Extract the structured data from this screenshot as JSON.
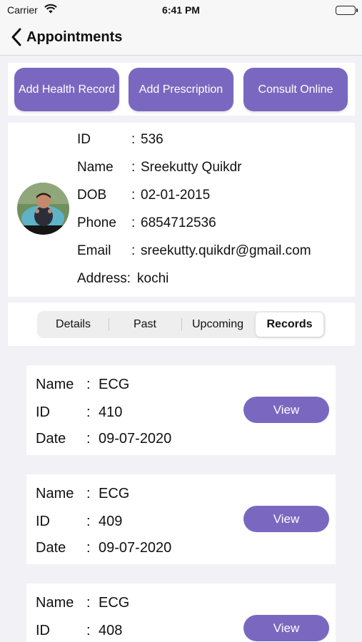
{
  "status_bar": {
    "carrier": "Carrier",
    "time": "6:41 PM"
  },
  "nav": {
    "back_label": "Appointments"
  },
  "actions": [
    {
      "label": "Add Health Record"
    },
    {
      "label": "Add Prescription"
    },
    {
      "label": "Consult Online"
    }
  ],
  "patient": {
    "fields": [
      {
        "label": "ID",
        "sep": ":",
        "value": "536"
      },
      {
        "label": "Name",
        "sep": ":",
        "value": "Sreekutty Quikdr"
      },
      {
        "label": "DOB",
        "sep": ":",
        "value": "02-01-2015"
      },
      {
        "label": "Phone",
        "sep": ":",
        "value": "6854712536"
      },
      {
        "label": "Email",
        "sep": ":",
        "value": "sreekutty.quikdr@gmail.com"
      },
      {
        "label": "Address:",
        "value": "kochi"
      }
    ]
  },
  "tabs": [
    {
      "label": "Details",
      "active": false
    },
    {
      "label": "Past",
      "active": false
    },
    {
      "label": "Upcoming",
      "active": false
    },
    {
      "label": "Records",
      "active": true
    }
  ],
  "records": [
    {
      "fields": [
        {
          "label": "Name",
          "sep": ":",
          "value": "ECG"
        },
        {
          "label": "ID",
          "sep": ":",
          "value": "410"
        },
        {
          "label": "Date",
          "sep": ":",
          "value": "09-07-2020"
        }
      ],
      "button": "View"
    },
    {
      "fields": [
        {
          "label": "Name",
          "sep": ":",
          "value": "ECG"
        },
        {
          "label": "ID",
          "sep": ":",
          "value": "409"
        },
        {
          "label": "Date",
          "sep": ":",
          "value": "09-07-2020"
        }
      ],
      "button": "View"
    },
    {
      "fields": [
        {
          "label": "Name",
          "sep": ":",
          "value": "ECG"
        },
        {
          "label": "ID",
          "sep": ":",
          "value": "408"
        }
      ],
      "button": "View"
    }
  ],
  "colors": {
    "accent": "#7a68c0",
    "background": "#f1f1f6"
  }
}
